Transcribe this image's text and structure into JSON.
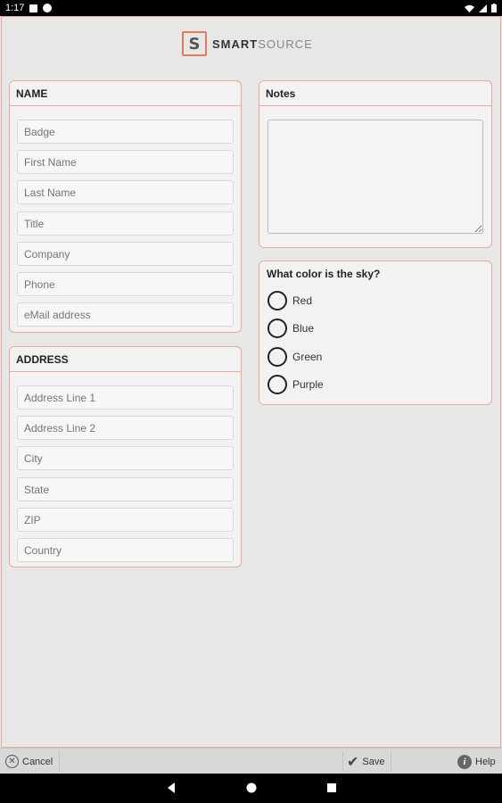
{
  "status_bar": {
    "time": "1:17"
  },
  "logo": {
    "mark": "S",
    "word_bold": "SMART",
    "word_light": "SOURCE"
  },
  "name_panel": {
    "title": "NAME",
    "fields": [
      "Badge",
      "First Name",
      "Last Name",
      "Title",
      "Company",
      "Phone",
      "eMail address"
    ]
  },
  "address_panel": {
    "title": "ADDRESS",
    "fields": [
      "Address Line 1",
      "Address Line 2",
      "City",
      "State",
      "ZIP",
      "Country"
    ]
  },
  "notes_panel": {
    "title": "Notes",
    "value": ""
  },
  "question_panel": {
    "question": "What color is the sky?",
    "options": [
      "Red",
      "Blue",
      "Green",
      "Purple"
    ]
  },
  "bottom_bar": {
    "cancel_label": "Cancel",
    "save_label": "Save",
    "help_label": "Help"
  },
  "colors": {
    "accent": "#e07b5b",
    "border": "#e8a99a",
    "background": "#e7e7e7"
  }
}
